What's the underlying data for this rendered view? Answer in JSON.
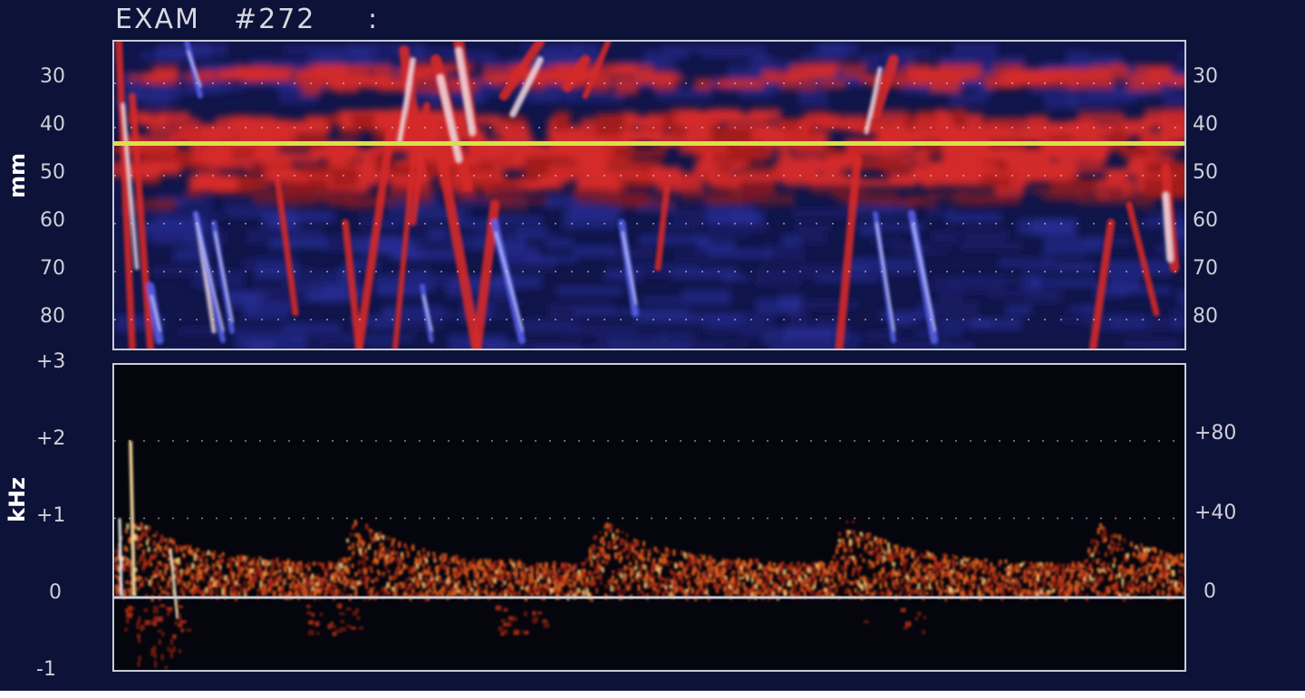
{
  "header": {
    "title": "EXAM",
    "exam_number": "#272",
    "separator": ":"
  },
  "mmode": {
    "axis_label": "mm",
    "ticks_left": [
      "30",
      "40",
      "50",
      "60",
      "70",
      "80"
    ],
    "ticks_right": [
      "30",
      "40",
      "50",
      "60",
      "70",
      "80"
    ],
    "cursor_depth_mm": 45,
    "colors": {
      "flow_toward": "#d42a2a",
      "flow_away": "#2a34c8",
      "cursor": "#d8e04a"
    }
  },
  "doppler": {
    "axis_label": "kHz",
    "ticks_left": [
      "+3",
      "+2",
      "+1",
      "0",
      "-1"
    ],
    "ticks_right": [
      "+80",
      "+40",
      "0"
    ],
    "colors": {
      "spectrum": "#e05a1c",
      "peak": "#ffd27a",
      "baseline": "#c8ccd6"
    }
  }
}
